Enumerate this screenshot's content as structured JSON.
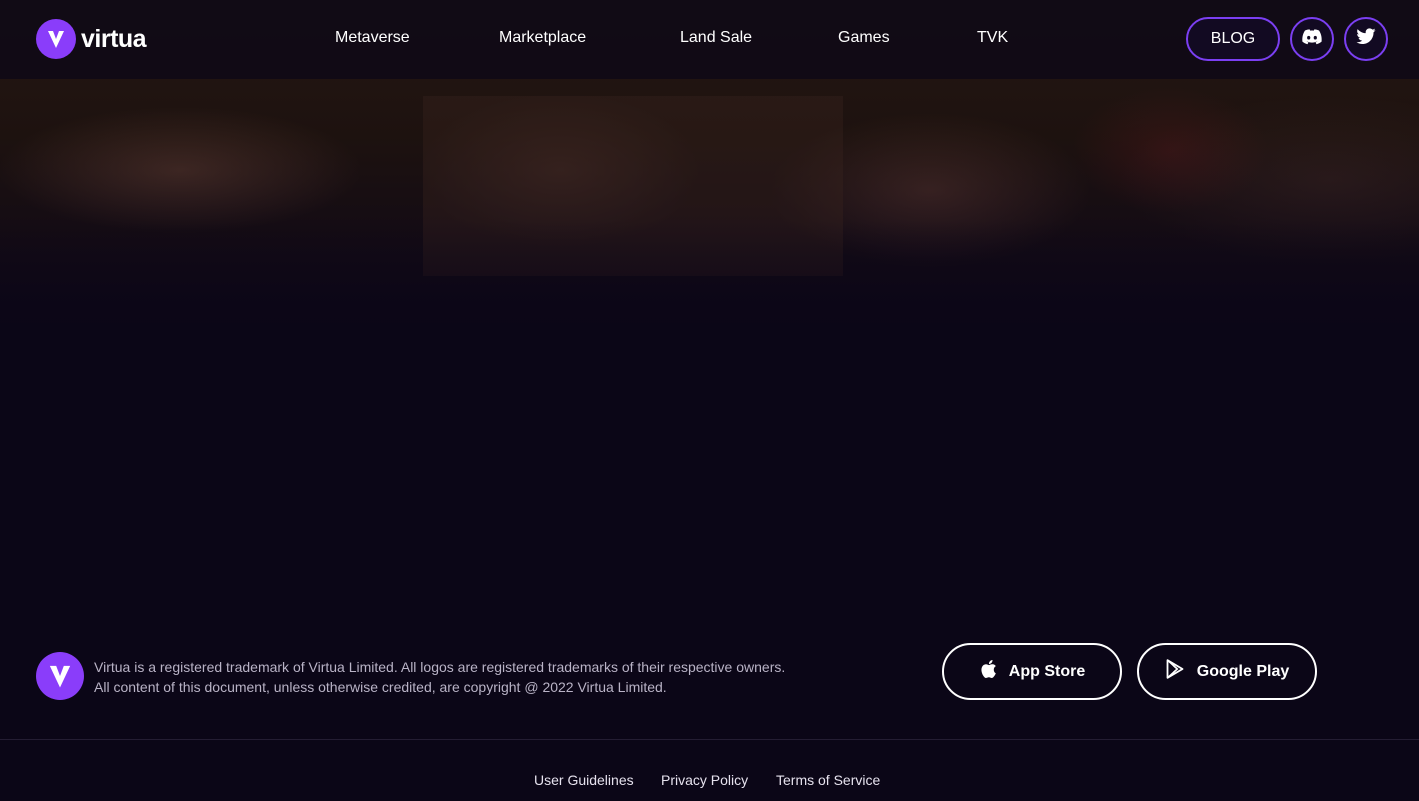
{
  "brand": {
    "name": "virtua",
    "accent_color": "#8a3dfa",
    "logo_icon": "virtua-v-icon"
  },
  "nav": {
    "items": [
      {
        "label": "Metaverse"
      },
      {
        "label": "Marketplace"
      },
      {
        "label": "Land Sale"
      },
      {
        "label": "Games"
      },
      {
        "label": "TVK"
      }
    ],
    "blog_label": "BLOG",
    "social": [
      {
        "icon": "discord-icon"
      },
      {
        "icon": "twitter-icon"
      }
    ]
  },
  "footer": {
    "legal_line_1": "Virtua is a registered trademark of Virtua Limited. All logos are registered trademarks of their respective owners.",
    "legal_line_2": "All content of this document, unless otherwise credited, are copyright @ 2022 Virtua Limited.",
    "app_store_label": "App Store",
    "google_play_label": "Google Play",
    "links": [
      {
        "label": "User Guidelines"
      },
      {
        "label": "Privacy Policy"
      },
      {
        "label": "Terms of Service"
      }
    ]
  }
}
